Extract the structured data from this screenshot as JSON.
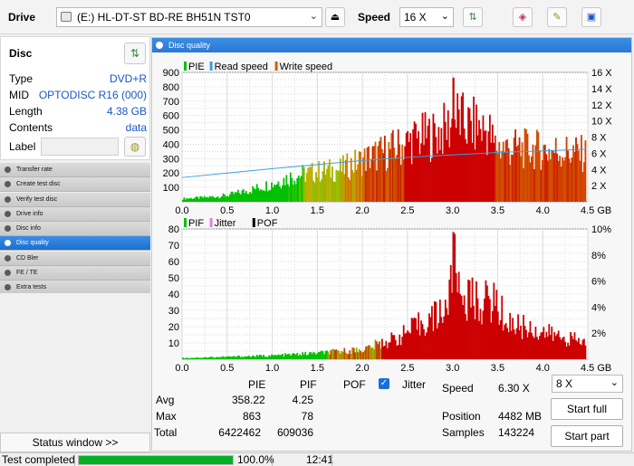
{
  "toolbar": {
    "drive_label": "Drive",
    "drive_value": "(E:)   HL-DT-ST BD-RE  BH51N TST0",
    "speed_label": "Speed",
    "speed_value": "16 X"
  },
  "disc": {
    "title": "Disc",
    "rows": [
      {
        "key": "Type",
        "value": "DVD+R"
      },
      {
        "key": "MID",
        "value": "OPTODISC R16 (000)"
      },
      {
        "key": "Length",
        "value": "4.38 GB"
      },
      {
        "key": "Contents",
        "value": "data"
      }
    ],
    "label_key": "Label",
    "label_value": ""
  },
  "nav": [
    {
      "label": "Transfer rate",
      "active": false
    },
    {
      "label": "Create test disc",
      "active": false
    },
    {
      "label": "Verify test disc",
      "active": false
    },
    {
      "label": "Drive info",
      "active": false
    },
    {
      "label": "Disc info",
      "active": false
    },
    {
      "label": "Disc quality",
      "active": true
    },
    {
      "label": "CD Bler",
      "active": false
    },
    {
      "label": "FE / TE",
      "active": false
    },
    {
      "label": "Extra tests",
      "active": false
    }
  ],
  "status_window_label": "Status window >>",
  "statusbar": {
    "text": "Test completed",
    "progress": 100.0,
    "percent_text": "100.0%",
    "time": "12:41"
  },
  "panel_title": "Disc quality",
  "colors": {
    "pie": "#00c000",
    "pie_high": "#cc0000",
    "read": "#3aa0e0",
    "write": "#d06000",
    "pif": "#cc0000",
    "jitter": "#e080e0",
    "pof": "#000000",
    "accent": "#2a79d6"
  },
  "chart_data": [
    {
      "type": "bar",
      "legend": [
        "PIE",
        "Read speed",
        "Write speed"
      ],
      "x_ticks": [
        "0.0",
        "0.5",
        "1.0",
        "1.5",
        "2.0",
        "2.5",
        "3.0",
        "3.5",
        "4.0",
        "4.5 GB"
      ],
      "y_ticks": [
        "900",
        "800",
        "700",
        "600",
        "500",
        "400",
        "300",
        "200",
        "100"
      ],
      "y2_ticks": [
        "16 X",
        "14 X",
        "12 X",
        "10 X",
        "8 X",
        "6 X",
        "4 X",
        "2 X"
      ],
      "xlim": [
        0,
        4.5
      ],
      "ylim": [
        0,
        900
      ],
      "y2lim": [
        0,
        16
      ],
      "envelope": [
        [
          0,
          30
        ],
        [
          0.25,
          40
        ],
        [
          0.5,
          60
        ],
        [
          0.75,
          110
        ],
        [
          1.0,
          170
        ],
        [
          1.2,
          230
        ],
        [
          1.3,
          250
        ],
        [
          1.5,
          280
        ],
        [
          1.75,
          300
        ],
        [
          2.0,
          390
        ],
        [
          2.2,
          450
        ],
        [
          2.4,
          510
        ],
        [
          2.6,
          590
        ],
        [
          2.8,
          620
        ],
        [
          2.95,
          690
        ],
        [
          3.05,
          780
        ],
        [
          3.15,
          700
        ],
        [
          3.25,
          700
        ],
        [
          3.4,
          650
        ],
        [
          3.45,
          520
        ],
        [
          3.6,
          500
        ],
        [
          3.8,
          490
        ],
        [
          4.0,
          480
        ],
        [
          4.2,
          470
        ],
        [
          4.4,
          450
        ],
        [
          4.5,
          430
        ]
      ],
      "peak": {
        "x": 3.0,
        "y": 863
      },
      "read_speed": [
        [
          0,
          3.0
        ],
        [
          1.0,
          4.1
        ],
        [
          1.5,
          4.6
        ],
        [
          2.0,
          5.1
        ],
        [
          2.5,
          5.5
        ],
        [
          3.0,
          5.8
        ],
        [
          3.5,
          6.1
        ],
        [
          4.0,
          6.3
        ],
        [
          4.48,
          6.5
        ]
      ]
    },
    {
      "type": "bar",
      "legend": [
        "PIF",
        "Jitter",
        "POF"
      ],
      "x_ticks": [
        "0.0",
        "0.5",
        "1.0",
        "1.5",
        "2.0",
        "2.5",
        "3.0",
        "3.5",
        "4.0",
        "4.5 GB"
      ],
      "y_ticks": [
        "80",
        "70",
        "60",
        "50",
        "40",
        "30",
        "20",
        "10"
      ],
      "y2_ticks": [
        "10%",
        "8%",
        "6%",
        "4%",
        "2%"
      ],
      "xlim": [
        0,
        4.5
      ],
      "ylim": [
        0,
        80
      ],
      "y2lim": [
        0,
        10
      ],
      "envelope": [
        [
          0,
          1
        ],
        [
          0.5,
          2
        ],
        [
          1.0,
          3
        ],
        [
          1.5,
          5
        ],
        [
          2.0,
          8
        ],
        [
          2.2,
          13
        ],
        [
          2.4,
          18
        ],
        [
          2.6,
          27
        ],
        [
          2.8,
          35
        ],
        [
          2.95,
          45
        ],
        [
          3.0,
          78
        ],
        [
          3.1,
          52
        ],
        [
          3.3,
          46
        ],
        [
          3.45,
          48
        ],
        [
          3.6,
          30
        ],
        [
          3.8,
          26
        ],
        [
          4.0,
          22
        ],
        [
          4.2,
          18
        ],
        [
          4.4,
          15
        ],
        [
          4.5,
          12
        ]
      ],
      "peak": {
        "x": 3.0,
        "y": 78
      }
    }
  ],
  "stats": {
    "headers": [
      "PIE",
      "PIF",
      "POF",
      "Jitter"
    ],
    "rows": [
      {
        "label": "Avg",
        "pie": "358.22",
        "pif": "4.25"
      },
      {
        "label": "Max",
        "pie": "863",
        "pif": "78"
      },
      {
        "label": "Total",
        "pie": "6422462",
        "pif": "609036"
      }
    ],
    "speed_label": "Speed",
    "speed_value": "6.30 X",
    "position_label": "Position",
    "position_value": "4482 MB",
    "samples_label": "Samples",
    "samples_value": "143224",
    "rate_value": "8 X",
    "start_full": "Start full",
    "start_part": "Start part"
  }
}
